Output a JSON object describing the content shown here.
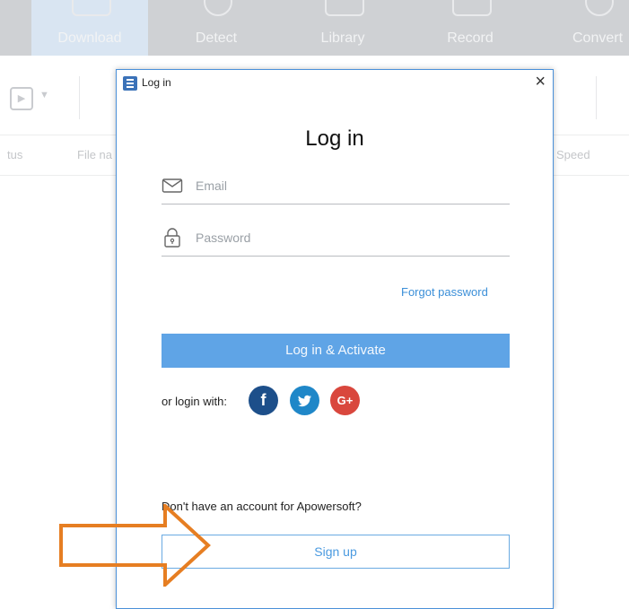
{
  "app": {
    "tabs": [
      {
        "label": "Download"
      },
      {
        "label": "Detect"
      },
      {
        "label": "Library"
      },
      {
        "label": "Record"
      },
      {
        "label": "Convert"
      }
    ],
    "columns": [
      "tus",
      "File na",
      "Speed"
    ]
  },
  "dialog": {
    "window_title": "Log in",
    "close_label": "×",
    "heading": "Log in",
    "email_placeholder": "Email",
    "password_placeholder": "Password",
    "forgot_label": "Forgot password",
    "primary_label": "Log in & Activate",
    "social_label": "or login with:",
    "social": [
      {
        "name": "facebook",
        "glyph": "f",
        "color": "#1d4f8a"
      },
      {
        "name": "twitter",
        "glyph": "t",
        "color": "#1f87c8"
      },
      {
        "name": "google-plus",
        "glyph": "G+",
        "color": "#d9473d"
      }
    ],
    "no_account_text": "Don't have an account for Apowersoft?",
    "signup_label": "Sign up"
  },
  "annotation": {
    "arrow_color": "#e67e22"
  },
  "colors": {
    "accent": "#5fa4e6",
    "link": "#3b8fd8",
    "dialog_border": "#4a90d9"
  }
}
